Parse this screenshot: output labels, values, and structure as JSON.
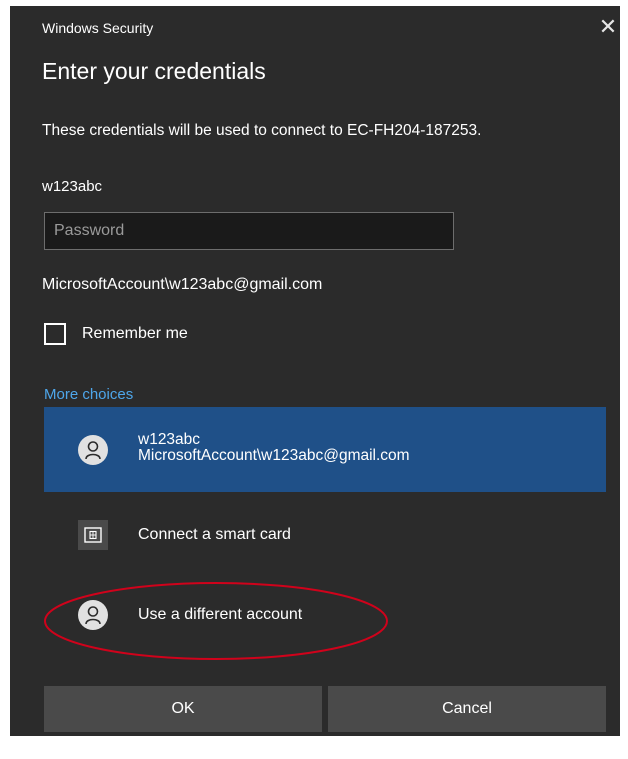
{
  "window": {
    "title": "Windows Security",
    "close_glyph": "✕"
  },
  "heading": "Enter your credentials",
  "description": "These credentials will be used to connect to EC-FH204-187253.",
  "username": "w123abc",
  "password": {
    "placeholder": "Password",
    "value": ""
  },
  "account_label": "MicrosoftAccount\\w123abc@gmail.com",
  "remember": {
    "label": "Remember me",
    "checked": false
  },
  "more_choices": {
    "label": "More choices",
    "options": [
      {
        "line1": "w123abc",
        "line2": "MicrosoftAccount\\w123abc@gmail.com",
        "icon": "person-icon",
        "selected": true
      },
      {
        "line1": "Connect a smart card",
        "icon": "smart-card-icon",
        "selected": false
      },
      {
        "line1": "Use a different account",
        "icon": "person-icon",
        "selected": false
      }
    ]
  },
  "buttons": {
    "ok": "OK",
    "cancel": "Cancel"
  },
  "colors": {
    "dialog_bg": "#2b2b2b",
    "accent_link": "#4ea6ea",
    "selected_bg": "#1f5088",
    "button_bg": "#4a4a4a",
    "annotation": "#d0021b"
  }
}
